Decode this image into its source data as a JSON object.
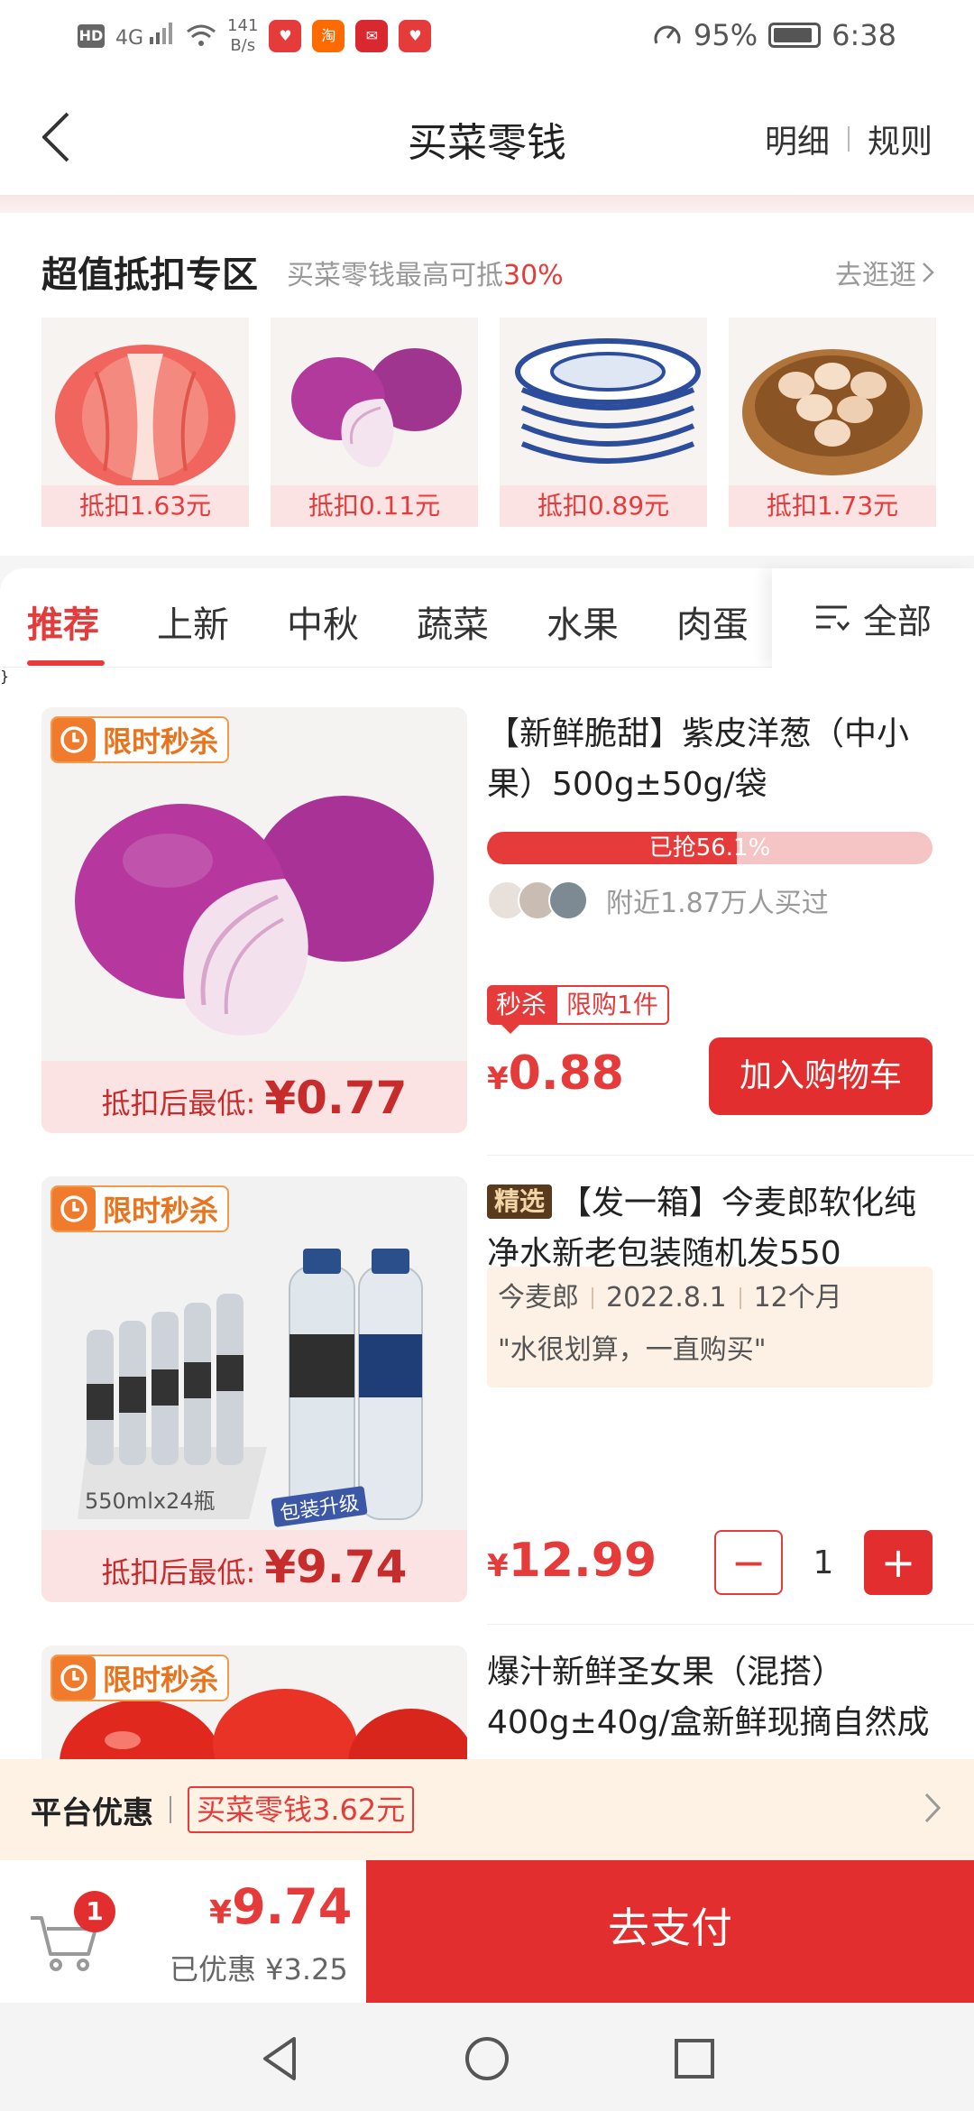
{
  "status_bar": {
    "hd": "HD",
    "signal": "4G",
    "speed_value": "141",
    "speed_unit": "B/s",
    "battery": "95%",
    "time": "6:38"
  },
  "nav": {
    "title": "买菜零钱",
    "detail": "明细",
    "rules": "规则"
  },
  "zone": {
    "title": "超值抵扣专区",
    "subtitle": "买菜零钱最高可抵",
    "subtitle_pct": "30%",
    "more": "去逛逛",
    "items": [
      {
        "deduct": "抵扣1.63元",
        "icon": "pomelo-image"
      },
      {
        "deduct": "抵扣0.11元",
        "icon": "onion-image"
      },
      {
        "deduct": "抵扣0.89元",
        "icon": "bowls-image"
      },
      {
        "deduct": "抵扣1.73元",
        "icon": "eggs-image"
      }
    ]
  },
  "tabs": {
    "items": [
      "推荐",
      "上新",
      "中秋",
      "蔬菜",
      "水果",
      "肉蛋"
    ],
    "all": "全部"
  },
  "products": [
    {
      "badge": "限时秒杀",
      "title": "【新鲜脆甜】紫皮洋葱（中小果）500g±50g/袋",
      "progress_text": "已抢56.1%",
      "progress": 0.561,
      "buyers": "附近1.87万人买过",
      "ms_tag": "秒杀",
      "limit_tag": "限购1件",
      "price_currency": "¥",
      "price": "0.88",
      "deduct_label": "抵扣后最低:",
      "deduct_price": "¥0.77",
      "add_cart": "加入购物车"
    },
    {
      "badge": "限时秒杀",
      "select_tag": "精选",
      "title": "【发一箱】今麦郎软化纯净水新老包装随机发550",
      "brand": "今麦郎",
      "date": "2022.8.1",
      "shelf": "12个月",
      "review": "\"水很划算，一直购买\"",
      "img_caption": "550mlx24瓶",
      "img_ribbon": "包装升级",
      "price_currency": "¥",
      "price": "12.99",
      "deduct_label": "抵扣后最低:",
      "deduct_price": "¥9.74",
      "qty": "1",
      "minus": "−",
      "plus": "+"
    },
    {
      "badge": "限时秒杀",
      "title": "爆汁新鲜圣女果（混搭）400g±40g/盒新鲜现摘自然成"
    }
  ],
  "promo": {
    "title": "平台优惠",
    "chip": "买菜零钱3.62元"
  },
  "checkout": {
    "cart_count": "1",
    "total_currency": "¥",
    "total": "9.74",
    "saved": "已优惠 ¥3.25",
    "pay": "去支付"
  },
  "colors": {
    "accent": "#e53b3b",
    "flash_orange": "#f07b2c",
    "promo_bg": "#fdf2e3"
  }
}
